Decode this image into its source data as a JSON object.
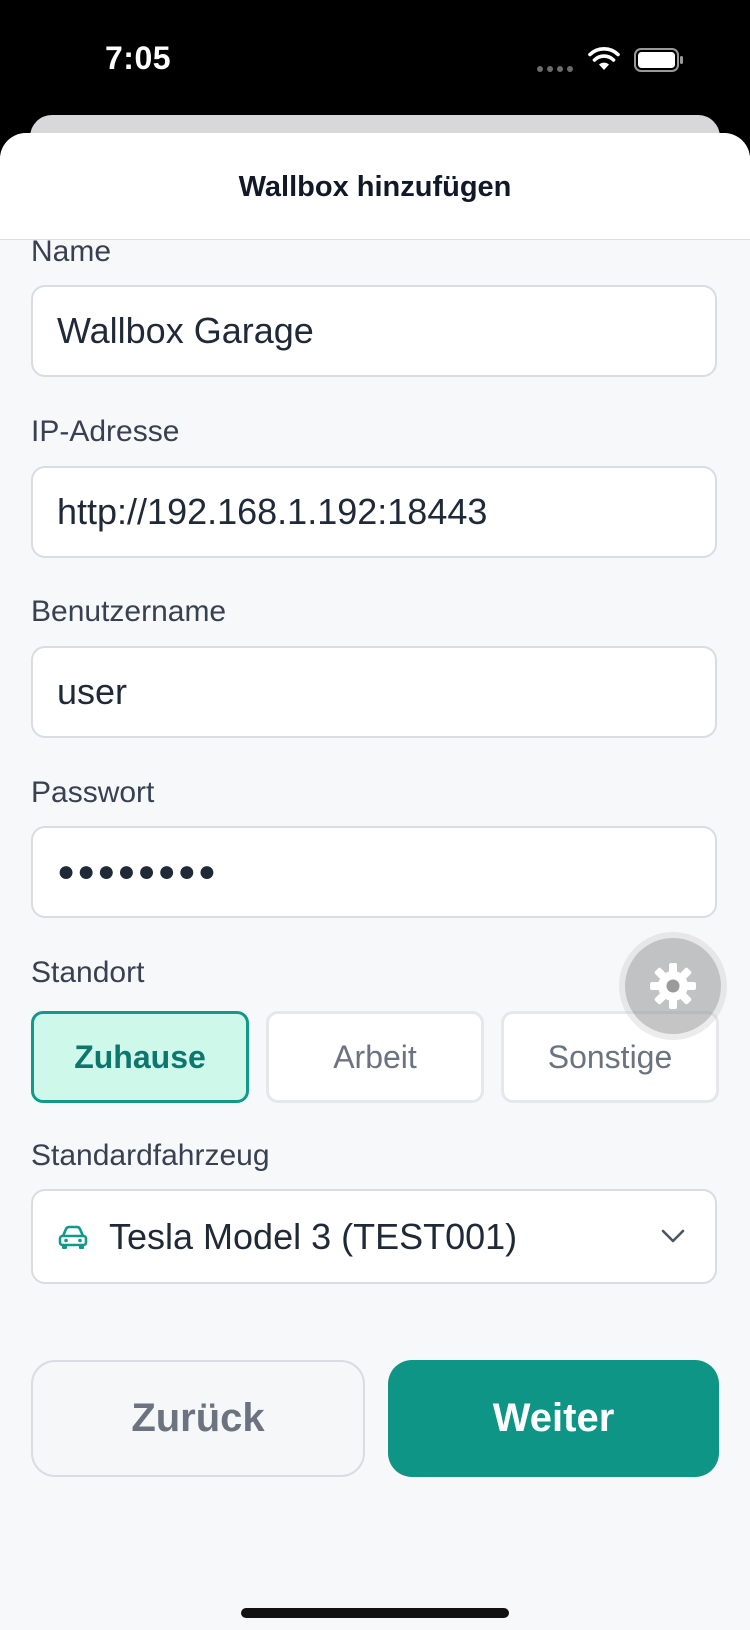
{
  "status_bar": {
    "time": "7:05"
  },
  "sheet": {
    "title": "Wallbox hinzufügen"
  },
  "form": {
    "name": {
      "label": "Name",
      "value": "Wallbox Garage"
    },
    "ip_address": {
      "label": "IP-Adresse",
      "value": "http://192.168.1.192:18443"
    },
    "username": {
      "label": "Benutzername",
      "value": "user"
    },
    "password": {
      "label": "Passwort",
      "value": "●●●●●●●●"
    },
    "location": {
      "label": "Standort",
      "options": [
        "Zuhause",
        "Arbeit",
        "Sonstige"
      ],
      "selected": "Zuhause"
    },
    "default_vehicle": {
      "label": "Standardfahrzeug",
      "value": "Tesla Model 3 (TEST001)"
    }
  },
  "buttons": {
    "back": "Zurück",
    "next": "Weiter"
  },
  "icons": {
    "wifi": "wifi-icon",
    "battery": "battery-icon",
    "car": "car-icon",
    "chevron": "chevron-down-icon",
    "settings": "gear-icon"
  },
  "colors": {
    "accent": "#0f9585",
    "accent_light": "#cdf8ea",
    "accent_border": "#13998a"
  }
}
